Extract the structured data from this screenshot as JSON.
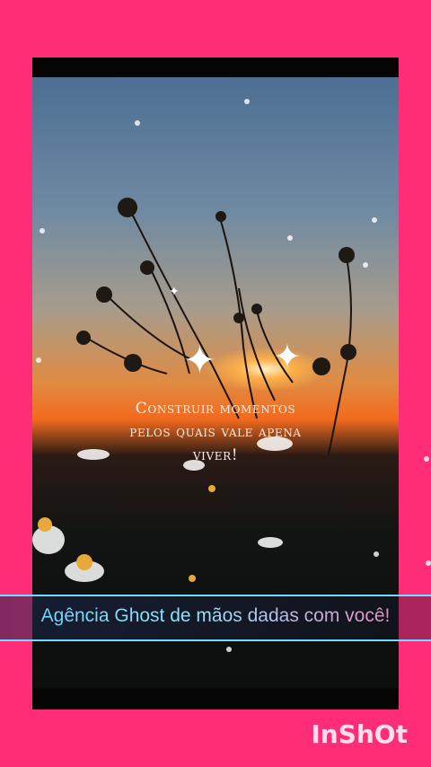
{
  "video": {
    "quote_lines": [
      "Construir momentos",
      "pelos quais vale apena",
      "viver!"
    ]
  },
  "banner": {
    "text": "Agência Ghost de mãos dadas com você!",
    "colors": [
      "#5fd3ff",
      "#ff7ab8"
    ],
    "border_color": "#6ee0ff"
  },
  "watermark": {
    "text": "InShOt"
  },
  "colors": {
    "background": "#ff2d78",
    "frame": "#050505"
  }
}
